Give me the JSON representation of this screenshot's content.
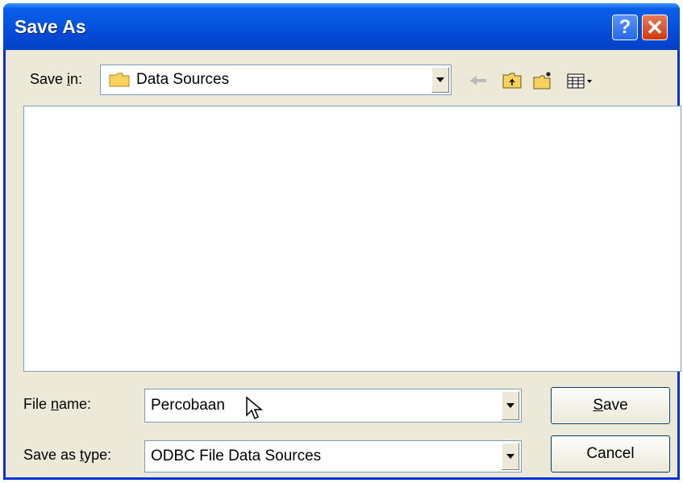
{
  "window": {
    "title": "Save As"
  },
  "titlebar_buttons": {
    "help": "?",
    "close": "✕"
  },
  "save_in": {
    "label_prefix": "Save ",
    "label_accel": "i",
    "label_suffix": "n:",
    "value": "Data Sources"
  },
  "toolbar": {
    "icons": [
      "back-arrow-icon",
      "up-folder-icon",
      "new-folder-icon",
      "view-menu-icon"
    ]
  },
  "file_name": {
    "label_prefix": "File ",
    "label_accel": "n",
    "label_suffix": "ame:",
    "value": "Percobaan"
  },
  "save_as_type": {
    "label_prefix": "Save as ",
    "label_accel": "t",
    "label_suffix": "ype:",
    "value": "ODBC File Data Sources"
  },
  "buttons": {
    "save_accel": "S",
    "save_rest": "ave",
    "cancel": "Cancel"
  },
  "colors": {
    "titlebar": "#0556e1",
    "dialog_bg": "#ece9d8",
    "border": "#7f9db9"
  }
}
